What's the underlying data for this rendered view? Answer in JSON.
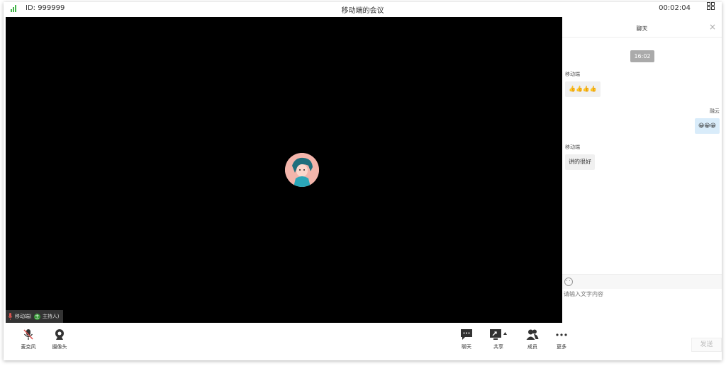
{
  "header": {
    "meeting_id": "ID: 999999",
    "title": "移动端的会议",
    "timer": "00:02:04"
  },
  "video": {
    "participant_name": "移动端(",
    "host_label": "主持人)",
    "host_icon_letter": "主"
  },
  "chat": {
    "title": "聊天",
    "close": "×",
    "time": "16:02",
    "messages": [
      {
        "sender": "移动端",
        "text": "👍👍👍👍"
      },
      {
        "sender": "融云",
        "text": "😀😀😀"
      },
      {
        "sender": "移动端",
        "text": "讲的很好"
      }
    ],
    "input_placeholder": "请输入文字内容",
    "send_label": "发送"
  },
  "toolbar": {
    "mic": "麦克风",
    "camera": "摄像头",
    "chat": "聊天",
    "share": "共享",
    "members": "成员",
    "more": "更多"
  },
  "colors": {
    "signal": "#43b649",
    "host_badge": "#3a9a3a",
    "muted": "#d9534f",
    "self_bubble": "#d9ecfa"
  }
}
